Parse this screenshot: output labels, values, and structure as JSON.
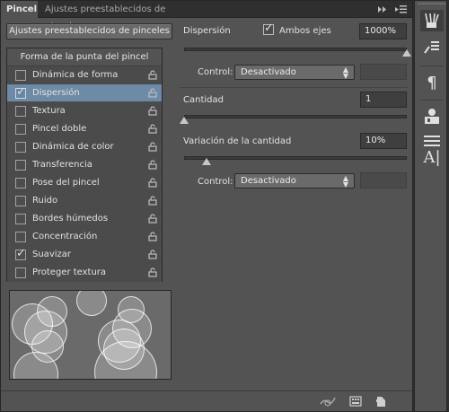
{
  "tabs": {
    "brush": "Pincel",
    "presets": "Ajustes preestablecidos de pinceles"
  },
  "presets_button": "Ajustes preestablecidos de pinceles",
  "list": {
    "header": "Forma de la punta del pincel",
    "items": [
      {
        "label": "Dinámica de forma",
        "checked": false,
        "selected": false
      },
      {
        "label": "Dispersión",
        "checked": true,
        "selected": true
      },
      {
        "label": "Textura",
        "checked": false,
        "selected": false
      },
      {
        "label": "Pincel doble",
        "checked": false,
        "selected": false
      },
      {
        "label": "Dinámica de color",
        "checked": false,
        "selected": false
      },
      {
        "label": "Transferencia",
        "checked": false,
        "selected": false
      },
      {
        "label": "Pose del pincel",
        "checked": false,
        "selected": false
      },
      {
        "label": "Ruido",
        "checked": false,
        "selected": false
      },
      {
        "label": "Bordes húmedos",
        "checked": false,
        "selected": false
      },
      {
        "label": "Concentración",
        "checked": false,
        "selected": false
      },
      {
        "label": "Suavizar",
        "checked": true,
        "selected": false
      },
      {
        "label": "Proteger textura",
        "checked": false,
        "selected": false
      }
    ]
  },
  "scatter": {
    "label": "Dispersión",
    "both_axes_label": "Ambos ejes",
    "both_axes_checked": true,
    "value": "1000%",
    "slider_fraction": 1.0,
    "control_label": "Control:",
    "control_value": "Desactivado"
  },
  "count": {
    "label": "Cantidad",
    "value": "1",
    "slider_fraction": 0.0
  },
  "count_jitter": {
    "label": "Variación de la cantidad",
    "value": "10%",
    "slider_fraction": 0.1,
    "control_label": "Control:",
    "control_value": "Desactivado"
  },
  "colors": {
    "panel": "#535353",
    "selection": "#6d8aa6",
    "tabbar": "#2f2f2f"
  }
}
